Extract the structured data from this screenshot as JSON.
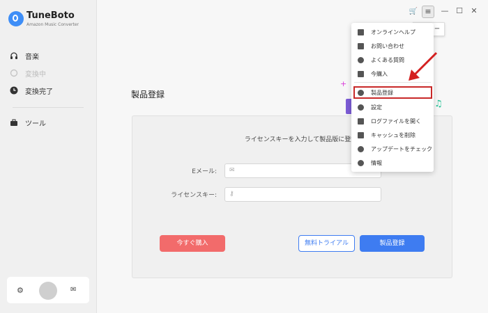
{
  "app": {
    "title": "TuneBoto",
    "subtitle": "Amazon Music Converter"
  },
  "sidebar": {
    "items": [
      {
        "label": "音楽",
        "icon": "headphones-icon"
      },
      {
        "label": "変換中",
        "icon": "sync-icon"
      },
      {
        "label": "変換完了",
        "icon": "clock-icon"
      },
      {
        "label": "ツール",
        "icon": "toolbox-icon"
      }
    ],
    "bottom": {
      "settings_icon": "gear-icon",
      "mail_icon": "mail-icon"
    }
  },
  "topbar": {
    "cart_icon": "cart-icon",
    "menu_icon": "menu-icon",
    "tooltip": "メニュー"
  },
  "main": {
    "page_title": "製品登録",
    "prompt": "ライセンスキーを入力して製品版に登録します",
    "email_label": "Eメール:",
    "key_label": "ライセンスキー:",
    "buy_now": "今すぐ購入",
    "free_trial": "無料トライアル",
    "register": "製品登録"
  },
  "menu": {
    "items": [
      {
        "label": "オンラインヘルプ",
        "icon": "graduation-cap-icon"
      },
      {
        "label": "お問い合わせ",
        "icon": "phone-icon"
      },
      {
        "label": "よくある質問",
        "icon": "question-icon"
      },
      {
        "label": "今購入",
        "icon": "cart-icon"
      },
      {
        "label": "製品登録",
        "icon": "user-key-icon"
      },
      {
        "label": "設定",
        "icon": "gear-icon"
      },
      {
        "label": "ログファイルを開く",
        "icon": "document-icon"
      },
      {
        "label": "キャッシュを削除",
        "icon": "broom-icon"
      },
      {
        "label": "アップデートをチェック",
        "icon": "refresh-icon"
      },
      {
        "label": "情報",
        "icon": "info-icon"
      }
    ]
  },
  "colors": {
    "accent": "#3e7cf1",
    "buy": "#f26b6b",
    "highlight": "#c82828",
    "arrow": "#d42020"
  }
}
